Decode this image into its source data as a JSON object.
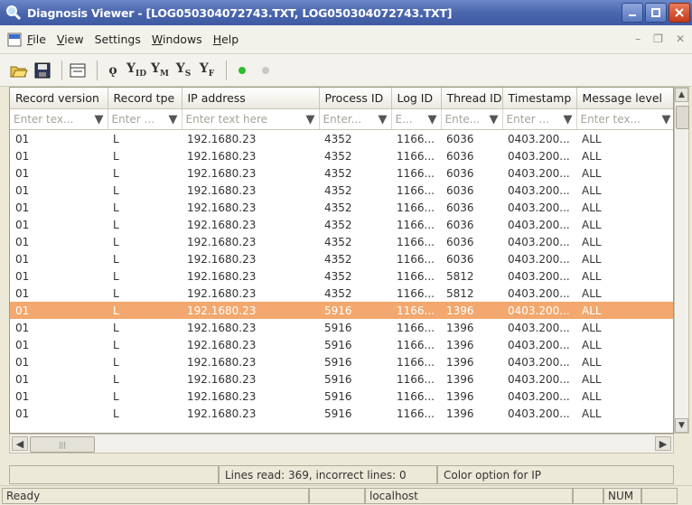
{
  "window": {
    "title": "Diagnosis Viewer - [LOG050304072743.TXT, LOG050304072743.TXT]"
  },
  "menu": {
    "items": [
      {
        "label": "File",
        "ul": "F",
        "rest": "ile"
      },
      {
        "label": "View",
        "ul": "V",
        "rest": "iew"
      },
      {
        "label": "Settings",
        "ul": "",
        "rest": "Settings"
      },
      {
        "label": "Windows",
        "ul": "W",
        "rest": "indows"
      },
      {
        "label": "Help",
        "ul": "H",
        "rest": "elp"
      }
    ]
  },
  "toolbar": {
    "filter_subs": [
      "",
      "ID",
      "M",
      "S",
      "F"
    ]
  },
  "columns": [
    {
      "label": "Record version",
      "placeholder": "Enter tex..."
    },
    {
      "label": "Record tpe",
      "placeholder": "Enter ..."
    },
    {
      "label": "IP address",
      "placeholder": "Enter text here"
    },
    {
      "label": "Process ID",
      "placeholder": "Enter..."
    },
    {
      "label": "Log ID",
      "placeholder": "E..."
    },
    {
      "label": "Thread ID",
      "placeholder": "Ente..."
    },
    {
      "label": "Timestamp",
      "placeholder": "Enter ..."
    },
    {
      "label": "Message level",
      "placeholder": "Enter tex..."
    }
  ],
  "rows": [
    [
      "01",
      "L",
      "192.1680.23",
      "4352",
      "1166...",
      "6036",
      "0403.200...",
      "ALL"
    ],
    [
      "01",
      "L",
      "192.1680.23",
      "4352",
      "1166...",
      "6036",
      "0403.200...",
      "ALL"
    ],
    [
      "01",
      "L",
      "192.1680.23",
      "4352",
      "1166...",
      "6036",
      "0403.200...",
      "ALL"
    ],
    [
      "01",
      "L",
      "192.1680.23",
      "4352",
      "1166...",
      "6036",
      "0403.200...",
      "ALL"
    ],
    [
      "01",
      "L",
      "192.1680.23",
      "4352",
      "1166...",
      "6036",
      "0403.200...",
      "ALL"
    ],
    [
      "01",
      "L",
      "192.1680.23",
      "4352",
      "1166...",
      "6036",
      "0403.200...",
      "ALL"
    ],
    [
      "01",
      "L",
      "192.1680.23",
      "4352",
      "1166...",
      "6036",
      "0403.200...",
      "ALL"
    ],
    [
      "01",
      "L",
      "192.1680.23",
      "4352",
      "1166...",
      "6036",
      "0403.200...",
      "ALL"
    ],
    [
      "01",
      "L",
      "192.1680.23",
      "4352",
      "1166...",
      "5812",
      "0403.200...",
      "ALL"
    ],
    [
      "01",
      "L",
      "192.1680.23",
      "4352",
      "1166...",
      "5812",
      "0403.200...",
      "ALL"
    ],
    [
      "01",
      "L",
      "192.1680.23",
      "5916",
      "1166...",
      "1396",
      "0403.200...",
      "ALL"
    ],
    [
      "01",
      "L",
      "192.1680.23",
      "5916",
      "1166...",
      "1396",
      "0403.200...",
      "ALL"
    ],
    [
      "01",
      "L",
      "192.1680.23",
      "5916",
      "1166...",
      "1396",
      "0403.200...",
      "ALL"
    ],
    [
      "01",
      "L",
      "192.1680.23",
      "5916",
      "1166...",
      "1396",
      "0403.200...",
      "ALL"
    ],
    [
      "01",
      "L",
      "192.1680.23",
      "5916",
      "1166...",
      "1396",
      "0403.200...",
      "ALL"
    ],
    [
      "01",
      "L",
      "192.1680.23",
      "5916",
      "1166...",
      "1396",
      "0403.200...",
      "ALL"
    ],
    [
      "01",
      "L",
      "192.1680.23",
      "5916",
      "1166...",
      "1396",
      "0403.200...",
      "ALL"
    ]
  ],
  "selected_row_index": 10,
  "info": {
    "lines": "Lines read: 369, incorrect lines: 0",
    "color_option": "Color option for IP"
  },
  "status": {
    "left": "Ready",
    "host": "localhost",
    "num": "NUM"
  },
  "colors": {
    "selection": "#f2a86e",
    "title_bar": "#4a66ad",
    "toolbar_dot_active": "#2bbf2b",
    "toolbar_dot_inactive": "#c8c8c8"
  }
}
